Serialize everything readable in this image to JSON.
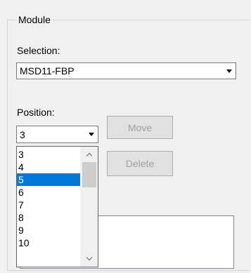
{
  "module": {
    "group_title": "Module",
    "selection_label": "Selection:",
    "selection_value": "MSD11-FBP",
    "position_label": "Position:",
    "position_value": "3",
    "move_button": "Move",
    "delete_button": "Delete"
  },
  "position_dropdown": {
    "items": [
      "3",
      "4",
      "5",
      "6",
      "7",
      "8",
      "9",
      "10"
    ],
    "selected_index": 2
  }
}
